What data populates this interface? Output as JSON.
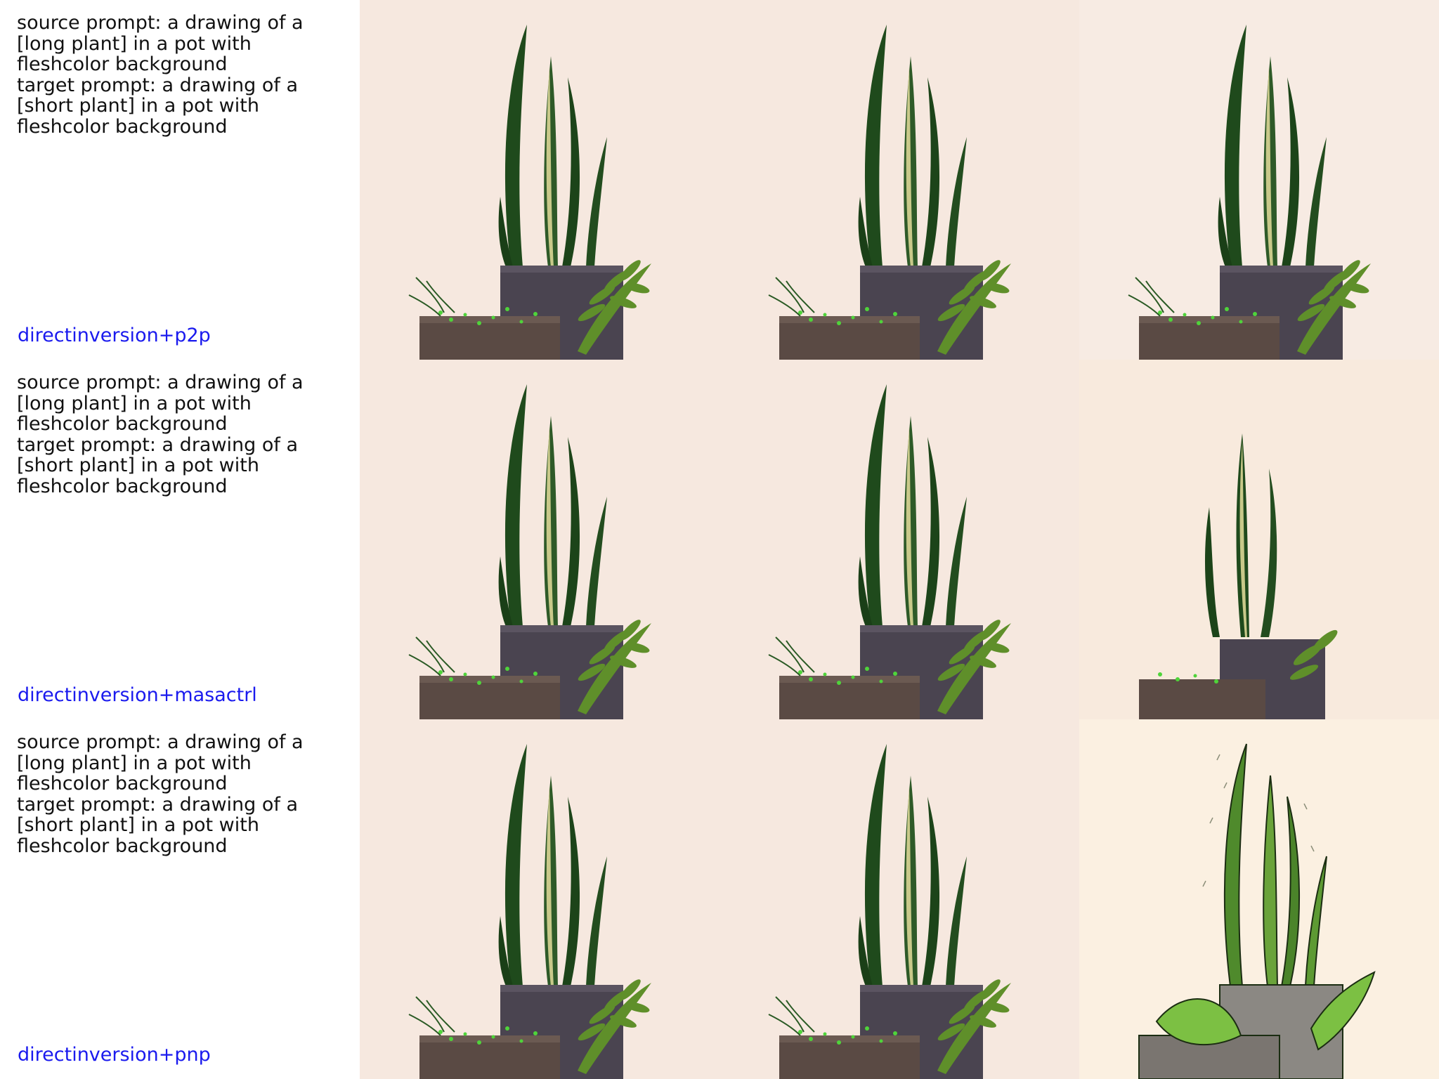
{
  "rows": [
    {
      "source_prompt": "source prompt: a drawing of a [long plant] in a pot with fleshcolor background",
      "target_prompt": "target prompt: a drawing of a [short plant] in a pot with fleshcolor background",
      "method": "directinversion+p2p"
    },
    {
      "source_prompt": "source prompt: a drawing of a [long plant] in a pot with fleshcolor background",
      "target_prompt": "target prompt: a drawing of a [short plant] in a pot with fleshcolor background",
      "method": "directinversion+masactrl"
    },
    {
      "source_prompt": "source prompt: a drawing of a [long plant] in a pot with fleshcolor background",
      "target_prompt": "target prompt: a drawing of a [short plant] in a pot with fleshcolor background",
      "method": "directinversion+pnp"
    }
  ],
  "colors": {
    "method_label": "#1a1aee",
    "background_flesh": "#f6e8df",
    "leaf_dark": "#1f4a1c",
    "leaf_stripe": "#c9c98a",
    "pot": "#4a4450",
    "fern": "#5f8f2a"
  }
}
